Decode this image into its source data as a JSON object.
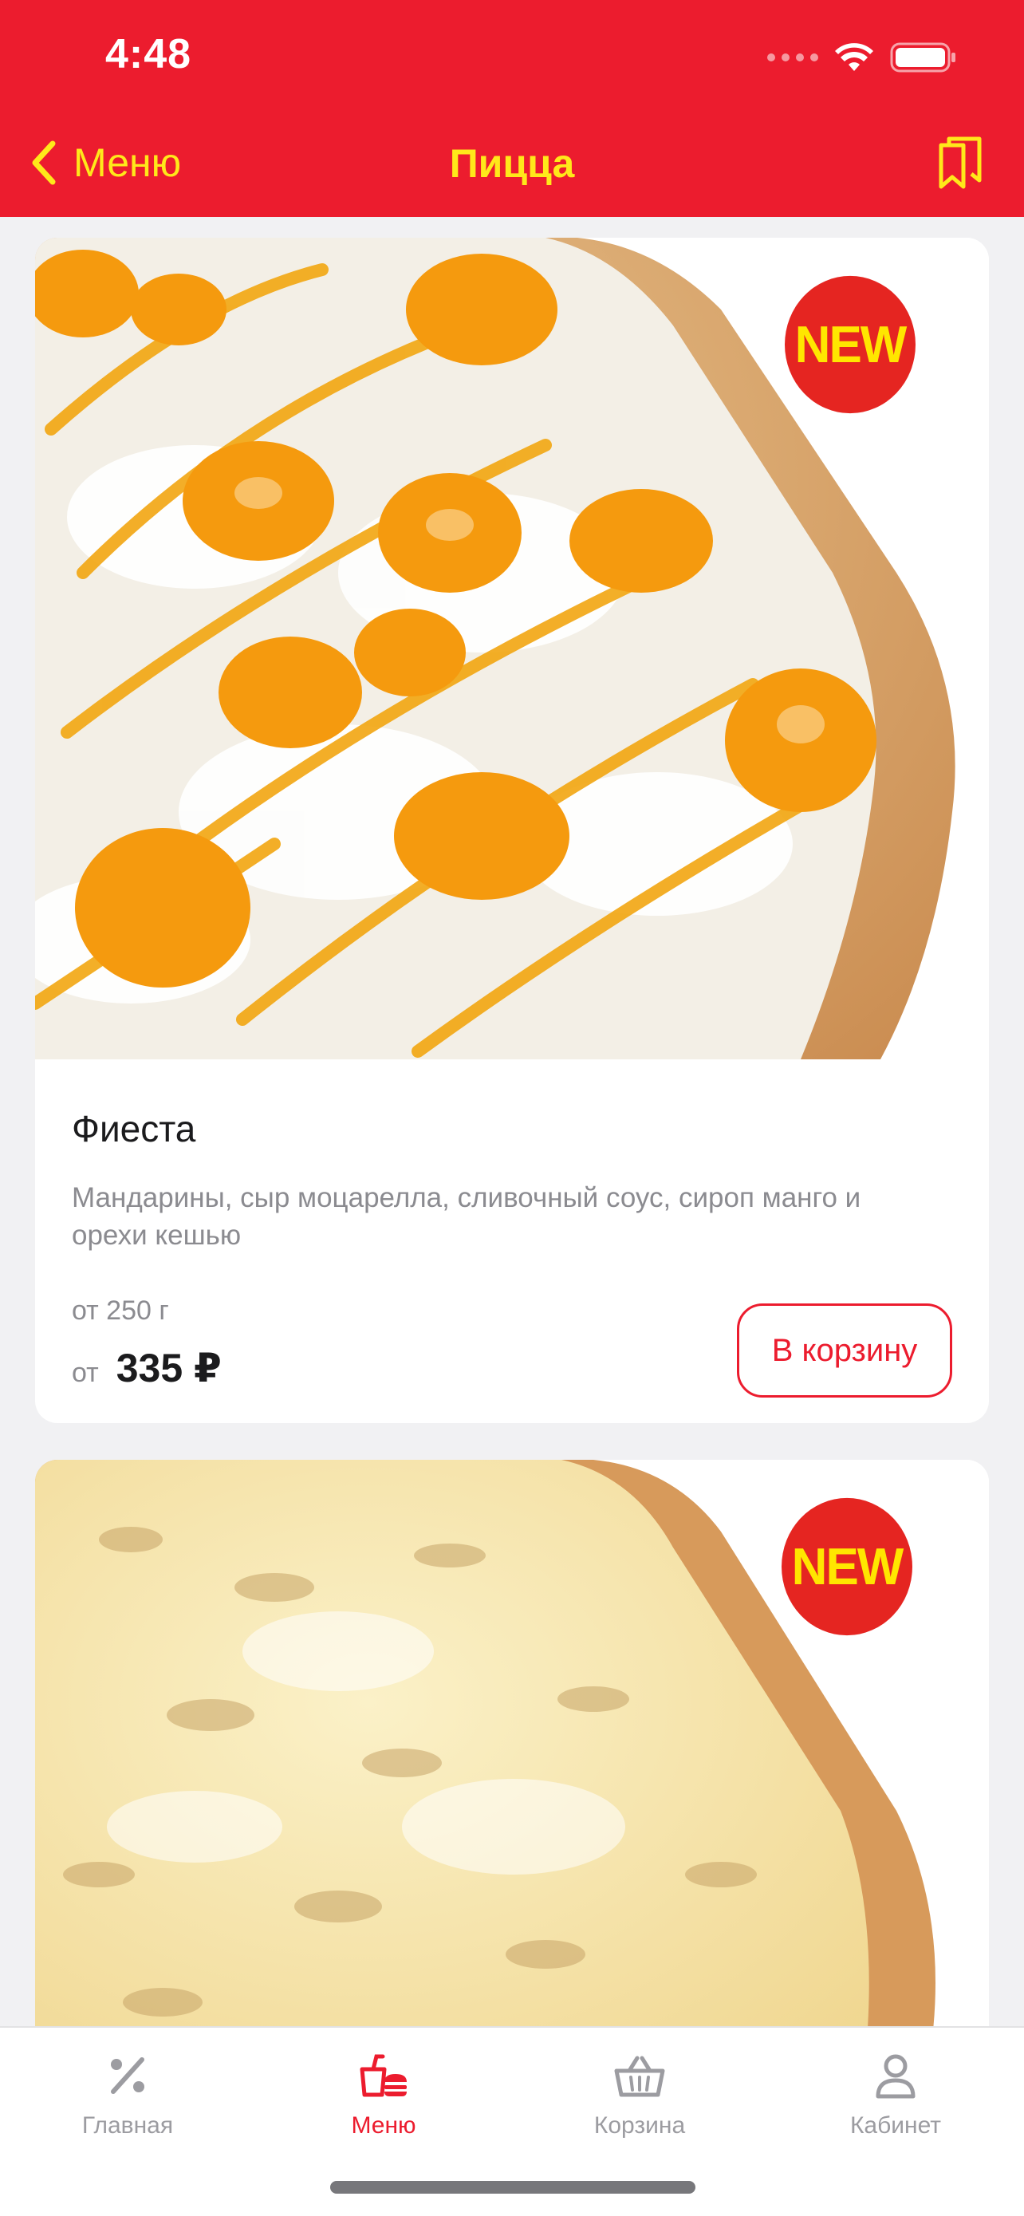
{
  "status_bar": {
    "time": "4:48"
  },
  "nav": {
    "back_label": "Меню",
    "title": "Пицца",
    "back_icon": "chevron-left-icon",
    "bookmark_icon": "bookmarks-icon"
  },
  "products": [
    {
      "badge": "NEW",
      "name": "Фиеста",
      "description": "Мандарины, сыр моцарелла, сливочный соус, сироп манго и орехи кешью",
      "weight": "от 250 г",
      "price_prefix": "от",
      "price": "335 ₽",
      "button": "В корзину"
    },
    {
      "badge": "NEW"
    }
  ],
  "tabbar": {
    "items": [
      {
        "label": "Главная",
        "icon": "percent-icon",
        "active": false
      },
      {
        "label": "Меню",
        "icon": "food-menu-icon",
        "active": true
      },
      {
        "label": "Корзина",
        "icon": "basket-icon",
        "active": false
      },
      {
        "label": "Кабинет",
        "icon": "user-icon",
        "active": false
      }
    ]
  },
  "colors": {
    "brand_red": "#ec1c2e",
    "accent_yellow": "#ffe81a",
    "badge_red": "#e52521"
  }
}
